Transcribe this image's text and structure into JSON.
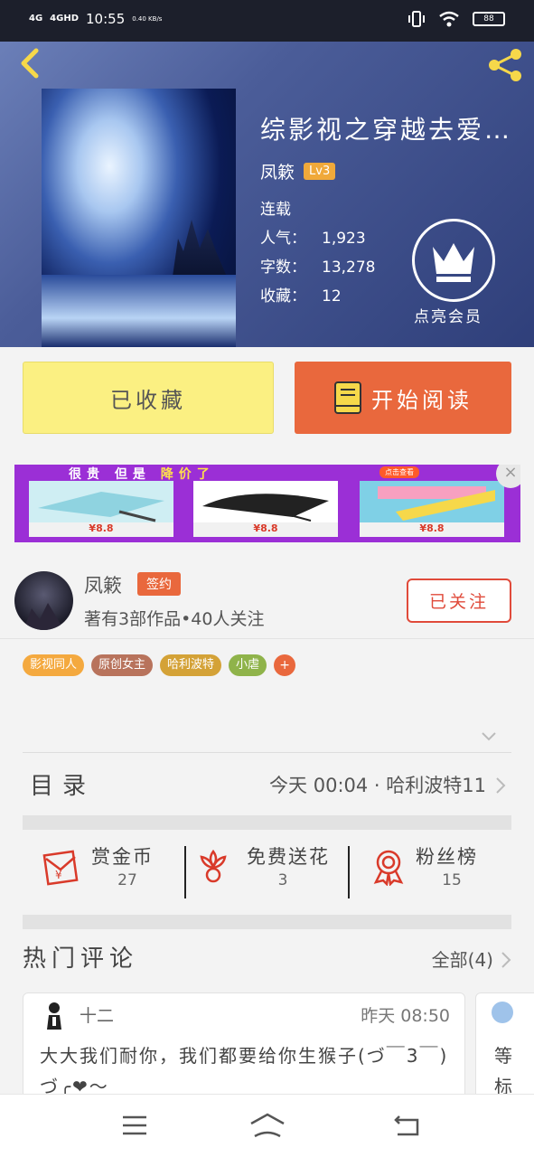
{
  "status_bar": {
    "signal1": "4G",
    "signal2": "4GHD",
    "time": "10:55",
    "speed": "0.40 KB/s",
    "battery": "88"
  },
  "book": {
    "title": "综影视之穿越去爱…",
    "author": "凤簌",
    "level": "Lv3",
    "status": "连载",
    "stats": [
      {
        "label": "人气：",
        "value": "1,923"
      },
      {
        "label": "字数：",
        "value": "13,278"
      },
      {
        "label": "收藏：",
        "value": "12"
      }
    ],
    "vip_label": "点亮会员"
  },
  "buttons": {
    "favorited": "已收藏",
    "start_reading": "开始阅读"
  },
  "ad": {
    "headline_a": "很贵 但是",
    "headline_b": "降价了",
    "pill": "点击查看",
    "price": "¥8.8",
    "close": "×"
  },
  "author_card": {
    "name": "凤簌",
    "badge": "签约",
    "meta": "著有3部作品•40人关注",
    "follow_label": "已关注"
  },
  "tags": [
    {
      "label": "影视同人",
      "color": "#f4a93f"
    },
    {
      "label": "原创女主",
      "color": "#b8735c"
    },
    {
      "label": "哈利波特",
      "color": "#d4a237"
    },
    {
      "label": "小虐",
      "color": "#8fb34a"
    }
  ],
  "tag_more": "+",
  "toc": {
    "label": "目录",
    "latest": "今天 00:04 · 哈利波特11"
  },
  "actions": [
    {
      "label": "赏金币",
      "value": "27",
      "icon": "red-envelope-icon"
    },
    {
      "label": "免费送花",
      "value": "3",
      "icon": "flower-icon"
    },
    {
      "label": "粉丝榜",
      "value": "15",
      "icon": "medal-icon"
    }
  ],
  "comments": {
    "title": "热门评论",
    "all_label": "全部(4)",
    "items": [
      {
        "user": "十二",
        "time": "昨天 08:50",
        "text": "大大我们耐你，我们都要给你生猴子(づ￣3￣)づ╭❤～"
      }
    ],
    "peek_text": "等\n标"
  },
  "colors": {
    "accent": "#e9683d",
    "fav_button": "#fbf082",
    "hero": "#4b5d99"
  }
}
